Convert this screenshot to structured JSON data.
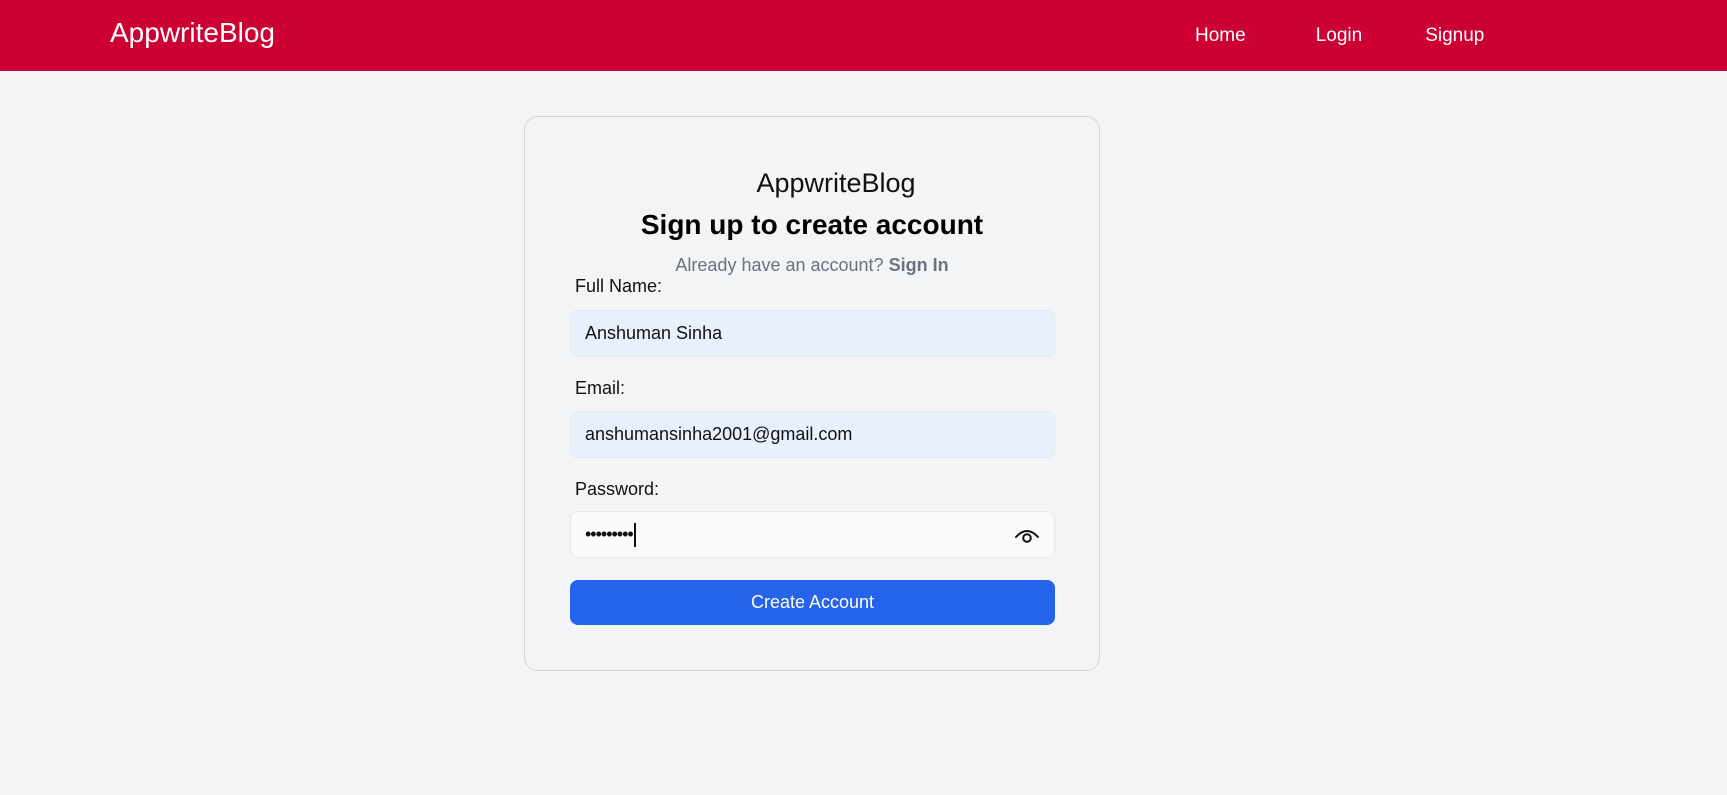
{
  "navbar": {
    "brand": "AppwriteBlog",
    "links": [
      "Home",
      "Login",
      "Signup"
    ]
  },
  "card": {
    "logo": "AppwriteBlog",
    "title": "Sign up to create account",
    "signin_prompt": "Already have an account?",
    "signin_link": "Sign In",
    "fields": {
      "name": {
        "label": "Full Name:",
        "value": "Anshuman Sinha"
      },
      "email": {
        "label": "Email:",
        "value": "anshumansinha2001@gmail.com"
      },
      "password": {
        "label": "Password:",
        "value": "•••••••••"
      }
    },
    "submit_label": "Create Account"
  },
  "colors": {
    "navbar": "#cc0033",
    "button": "#2563eb",
    "autofill": "#e8f0fe"
  },
  "icons": {
    "password_toggle": "eye-icon"
  }
}
